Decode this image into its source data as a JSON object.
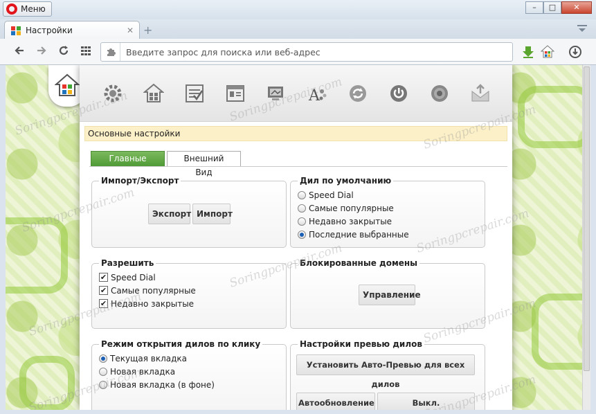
{
  "window": {
    "menu_label": "Меню",
    "minimize": "–",
    "maximize": "□",
    "close": "✕"
  },
  "tabs": [
    {
      "title": "Настройки",
      "close": "✕"
    }
  ],
  "newtab_symbol": "+",
  "address": {
    "placeholder": "Введите запрос для поиска или веб-адрес"
  },
  "settings": {
    "section_title": "Основные настройки",
    "tabs": [
      "Главные",
      "Внешний Вид"
    ],
    "import_export": {
      "legend": "Импорт/Экспорт",
      "export_label": "Экспорт",
      "import_label": "Импорт"
    },
    "default_dial": {
      "legend": "Дил по умолчанию",
      "options": [
        "Speed Dial",
        "Самые популярные",
        "Недавно закрытые",
        "Последние выбранные"
      ],
      "selected_index": 3
    },
    "allow": {
      "legend": "Разрешить",
      "options": [
        "Speed Dial",
        "Самые популярные",
        "Недавно закрытые"
      ],
      "checked": [
        true,
        true,
        true
      ]
    },
    "blocked": {
      "legend": "Блокированные домены",
      "manage_label": "Управление"
    },
    "open_mode": {
      "legend": "Режим открытия дилов по клику",
      "options": [
        "Текущая вкладка",
        "Новая вкладка",
        "Новая вкладка (в фоне)"
      ],
      "selected_index": 0
    },
    "preview": {
      "legend": "Настройки превью дилов",
      "auto_preview_label": "Установить Авто-Превью для всех дилов",
      "autoupdate_label": "Автообновление",
      "autoupdate_off_label": "Выкл. Автообновлен."
    }
  },
  "watermark": "Soringpcrepair.com",
  "colors": {
    "tab_active": "#5fa943",
    "notice_bg": "#fcf0c8",
    "opera_red": "#e3151c"
  }
}
